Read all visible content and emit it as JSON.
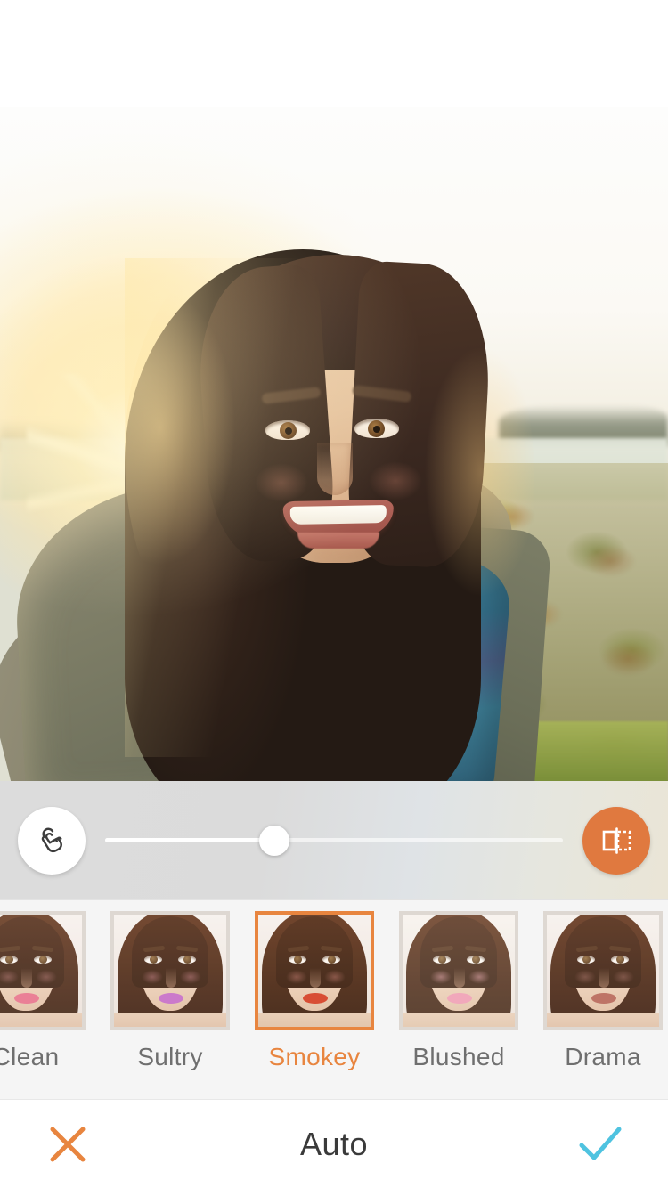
{
  "app": {
    "screen_title": "Auto",
    "accent_orange": "#e8853f",
    "confirm_cyan": "#4fc3e0"
  },
  "photo": {
    "alt": "Selfie of a smiling woman with long curly brown hair, wearing a teal scarf and olive jacket, backlit by golden sunlight in a countryside field",
    "subject": "smiling-woman-selfie"
  },
  "adjust_bar": {
    "touch_button": {
      "icon": "tap-gesture-icon",
      "label": "Touch retouch"
    },
    "compare_button": {
      "icon": "before-after-compare-icon",
      "label": "Compare"
    },
    "slider": {
      "name": "intensity-slider",
      "value": 37,
      "min": 0,
      "max": 100
    }
  },
  "filters": {
    "selected_index": 2,
    "items": [
      {
        "label": "Clean",
        "selected": false,
        "lip": "#e8738c",
        "cheek": "rgba(228,150,150,0.34)",
        "skin_tint": "rgba(255,250,246,0.10)"
      },
      {
        "label": "Sultry",
        "selected": false,
        "lip": "#c770c8",
        "cheek": "rgba(232,150,160,0.40)",
        "skin_tint": "rgba(255,246,240,0.08)"
      },
      {
        "label": "Smokey",
        "selected": true,
        "lip": "#d6432a",
        "cheek": "rgba(226,140,130,0.40)",
        "skin_tint": "rgba(255,240,226,0.06)"
      },
      {
        "label": "Blushed",
        "selected": false,
        "lip": "#ef9ab2",
        "cheek": "rgba(242,170,178,0.50)",
        "skin_tint": "rgba(255,252,250,0.14)"
      },
      {
        "label": "Drama",
        "selected": false,
        "lip": "#b96a5c",
        "cheek": "rgba(220,150,140,0.32)",
        "skin_tint": "rgba(252,244,236,0.08)"
      }
    ]
  },
  "bottom_bar": {
    "cancel": {
      "icon": "close-x-icon",
      "label": "Cancel"
    },
    "title": "Auto",
    "confirm": {
      "icon": "checkmark-icon",
      "label": "Apply"
    }
  }
}
